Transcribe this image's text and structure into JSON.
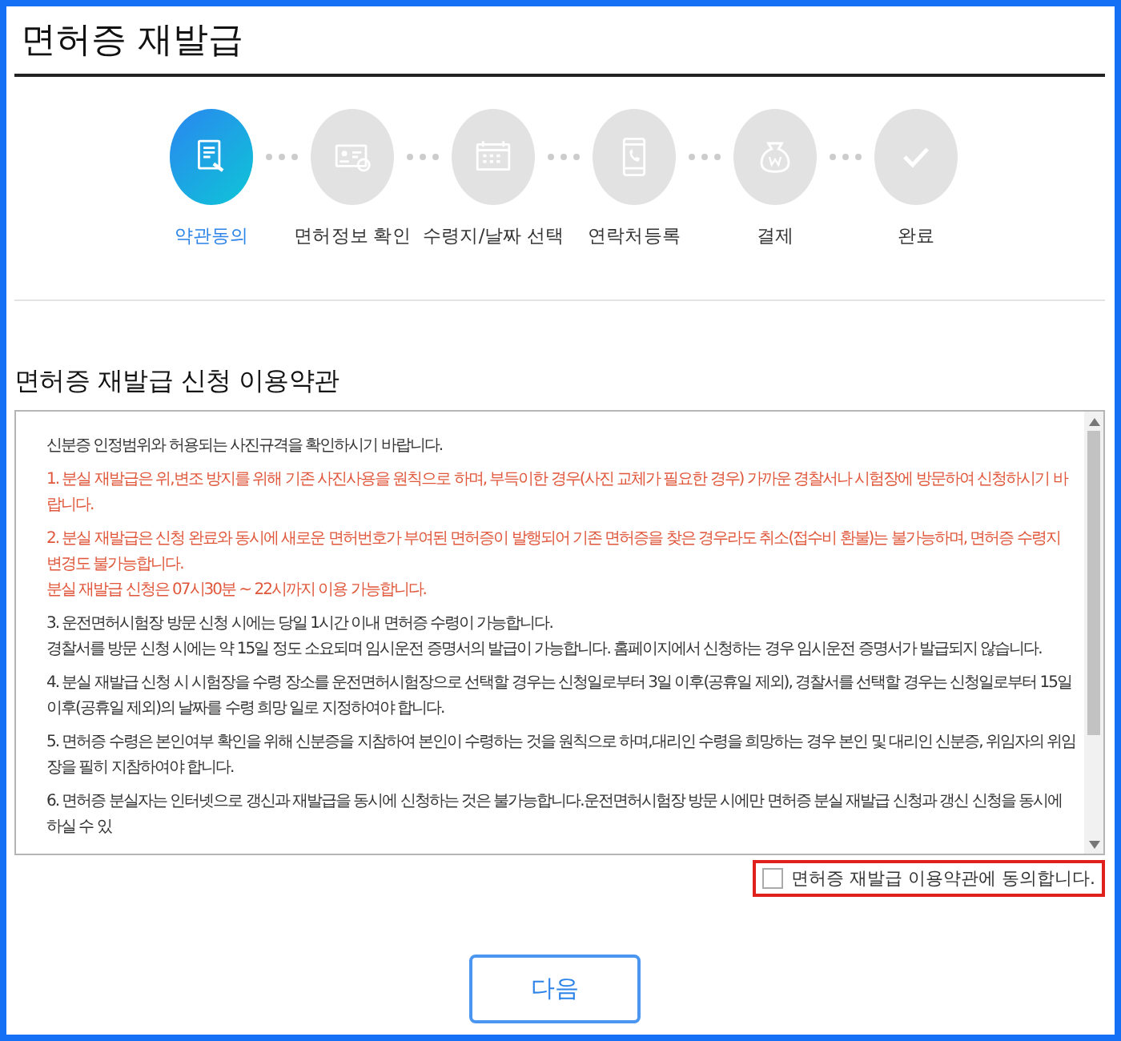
{
  "title": "면허증 재발급",
  "steps": [
    {
      "label": "약관동의",
      "selected": true
    },
    {
      "label": "면허정보 확인",
      "selected": false
    },
    {
      "label": "수령지/날짜 선택",
      "selected": false
    },
    {
      "label": "연락처등록",
      "selected": false
    },
    {
      "label": "결제",
      "selected": false
    },
    {
      "label": "완료",
      "selected": false
    }
  ],
  "terms": {
    "heading": "면허증 재발급 신청 이용약관",
    "paragraphs": [
      {
        "kind": "normal",
        "lines": [
          "신분증 인정범위와 허용되는 사진규격을 확인하시기 바랍니다."
        ]
      },
      {
        "kind": "warning",
        "lines": [
          "1. 분실 재발급은 위,변조 방지를 위해 기존 사진사용을 원칙으로 하며, 부득이한 경우(사진 교체가 필요한 경우) 가까운 경찰서나 시험장에 방문하여 신청하시기 바랍니다."
        ]
      },
      {
        "kind": "warning",
        "lines": [
          "2. 분실 재발급은 신청 완료와 동시에 새로운 면허번호가 부여된 면허증이 발행되어 기존 면허증을 찾은 경우라도 취소(접수비 환불)는 불가능하며, 면허증 수령지 변경도 불가능합니다.",
          "분실 재발급 신청은 07시30분 ~ 22시까지 이용 가능합니다."
        ]
      },
      {
        "kind": "normal",
        "lines": [
          "3. 운전면허시험장 방문 신청 시에는 당일 1시간 이내 면허증 수령이 가능합니다.",
          "경찰서를 방문 신청 시에는 약 15일 정도 소요되며 임시운전 증명서의 발급이 가능합니다. 홈페이지에서 신청하는 경우 임시운전 증명서가 발급되지 않습니다."
        ]
      },
      {
        "kind": "normal",
        "lines": [
          "4. 분실 재발급 신청 시 시험장을 수령 장소를 운전면허시험장으로 선택할 경우는 신청일로부터 3일 이후(공휴일 제외), 경찰서를 선택할 경우는 신청일로부터 15일 이후(공휴일 제외)의 날짜를 수령 희망 일로 지정하여야 합니다."
        ]
      },
      {
        "kind": "normal",
        "lines": [
          "5. 면허증 수령은 본인여부 확인을 위해 신분증을 지참하여 본인이 수령하는 것을 원칙으로 하며,대리인 수령을 희망하는 경우 본인 및 대리인 신분증, 위임자의 위임장을 필히 지참하여야 합니다."
        ]
      },
      {
        "kind": "normal",
        "lines": [
          "6. 면허증 분실자는 인터넷으로 갱신과 재발급을 동시에 신청하는 것은 불가능합니다.운전면허시험장 방문 시에만 면허증 분실 재발급 신청과 갱신 신청을 동시에 하실 수 있"
        ]
      }
    ]
  },
  "agreement": {
    "label": "면허증 재발급 이용약관에 동의합니다.",
    "checked": false,
    "highlighted": true
  },
  "next_button": "다음"
}
